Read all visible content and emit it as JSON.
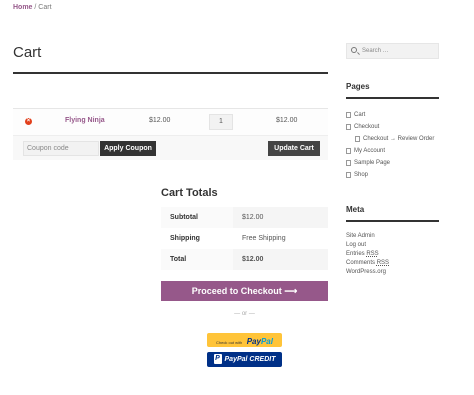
{
  "breadcrumb": {
    "home": "Home",
    "separator": " / ",
    "current": "Cart"
  },
  "page_title": "Cart",
  "cart": {
    "items": [
      {
        "name": "Flying Ninja",
        "price": "$12.00",
        "quantity": "1",
        "subtotal": "$12.00"
      }
    ],
    "coupon_placeholder": "Coupon code",
    "apply_coupon_label": "Apply Coupon",
    "update_cart_label": "Update Cart"
  },
  "totals": {
    "title": "Cart Totals",
    "rows": [
      {
        "label": "Subtotal",
        "value": "$12.00"
      },
      {
        "label": "Shipping",
        "value": "Free Shipping"
      },
      {
        "label": "Total",
        "value": "$12.00"
      }
    ],
    "checkout_label": "Proceed to Checkout",
    "checkout_arrow": "⟶",
    "or_label": "— or —",
    "paypal_small": "Check out with",
    "paypal_logo_pay": "Pay",
    "paypal_logo_pal": "Pal",
    "paypal_credit_mark": "P",
    "paypal_credit_label": "PayPal CREDIT"
  },
  "sidebar": {
    "search_placeholder": "Search …",
    "pages_title": "Pages",
    "pages": [
      {
        "label": "Cart",
        "child": false
      },
      {
        "label": "Checkout",
        "child": false
      },
      {
        "label": "Checkout → Review Order",
        "child": true
      },
      {
        "label": "My Account",
        "child": false
      },
      {
        "label": "Sample Page",
        "child": false
      },
      {
        "label": "Shop",
        "child": false
      }
    ],
    "meta_title": "Meta",
    "meta": {
      "site_admin": "Site Admin",
      "log_out": "Log out",
      "entries_prefix": "Entries ",
      "entries_rss": "RSS",
      "comments_prefix": "Comments ",
      "comments_rss": "RSS",
      "wordpress": "WordPress.org"
    }
  },
  "colors": {
    "accent": "#96588a",
    "dark_button": "#333333",
    "remove": "#e2401c",
    "paypal_gold": "#ffc439",
    "paypal_blue": "#003087"
  }
}
